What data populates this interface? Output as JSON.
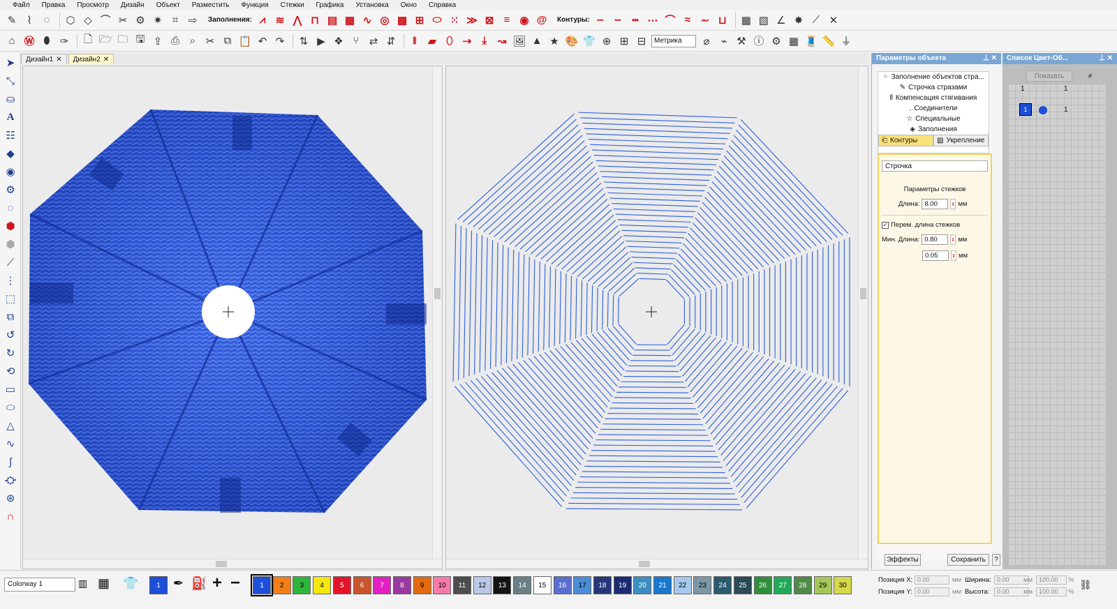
{
  "menu": [
    "Файл",
    "Правка",
    "Просмотр",
    "Дизайн",
    "Объект",
    "Разместить",
    "Функция",
    "Стежки",
    "Графика",
    "Установка",
    "Окно",
    "Справка"
  ],
  "toolbar": {
    "fills_label": "Заполнения:",
    "contours_label": "Контуры:",
    "units_value": "Метрика"
  },
  "tabs": [
    {
      "label": "Дизайн1",
      "active": false
    },
    {
      "label": "Дизайн2",
      "active": true
    }
  ],
  "props": {
    "title": "Параметры объекта",
    "items": [
      "Заполнение объектов стра...",
      "Строчка стразами",
      "Компенсация стягивания",
      "Соединители",
      "Специальные",
      "Заполнения"
    ],
    "tab_contours": "Контуры",
    "tab_reinforce": "Укрепление",
    "stitch_type": "Строчка",
    "section_label": "Параметры стежков",
    "length_label": "Длина:",
    "length_value": "8.00",
    "unit": "мм",
    "var_length_label": "Перем. длина стежков",
    "min_length_label": "Мин. Длина:",
    "min_length_value": "0.80",
    "extra_value": "0.05",
    "effects_button": "Эффекты",
    "save_button": "Сохранить",
    "help_button": "?"
  },
  "colorlist": {
    "title": "Список Цвет-Об...",
    "show_button": "Показать",
    "header_left": "1",
    "header_right": "1",
    "hash": "#",
    "row_swatch": "1",
    "row_count": "1"
  },
  "status": {
    "colorway": "Colorway 1",
    "current_color": "1",
    "pos_x_label": "Позиция X:",
    "pos_y_label": "Позиция Y:",
    "pos_x": "0.00",
    "pos_y": "0.00",
    "width_label": "Ширина:",
    "height_label": "Высота:",
    "width": "0.00",
    "height": "0.00",
    "scale_w": "100.00",
    "scale_h": "100.00",
    "pct": "%",
    "unit": "мм"
  },
  "palette": [
    {
      "n": "1",
      "color": "#1e4fd8"
    },
    {
      "n": "2",
      "color": "#f07f17"
    },
    {
      "n": "3",
      "color": "#2db53a"
    },
    {
      "n": "4",
      "color": "#f5e60e"
    },
    {
      "n": "5",
      "color": "#e4152a"
    },
    {
      "n": "6",
      "color": "#c9552c"
    },
    {
      "n": "7",
      "color": "#e21fc3"
    },
    {
      "n": "8",
      "color": "#9a3aa0"
    },
    {
      "n": "9",
      "color": "#e36a10"
    },
    {
      "n": "10",
      "color": "#f57aa9"
    },
    {
      "n": "11",
      "color": "#4d4d4d"
    },
    {
      "n": "12",
      "color": "#b9c9e9"
    },
    {
      "n": "13",
      "color": "#141414"
    },
    {
      "n": "14",
      "color": "#6a8087"
    },
    {
      "n": "15",
      "color": "#ffffff"
    },
    {
      "n": "16",
      "color": "#5a6fd2"
    },
    {
      "n": "17",
      "color": "#4a8dd9"
    },
    {
      "n": "18",
      "color": "#25367a"
    },
    {
      "n": "19",
      "color": "#1c2c74"
    },
    {
      "n": "20",
      "color": "#3a8fc0"
    },
    {
      "n": "21",
      "color": "#1878cc"
    },
    {
      "n": "22",
      "color": "#a6c9eb"
    },
    {
      "n": "23",
      "color": "#7c97a6"
    },
    {
      "n": "24",
      "color": "#2a5a6e"
    },
    {
      "n": "25",
      "color": "#2b4a58"
    },
    {
      "n": "26",
      "color": "#2f8f3a"
    },
    {
      "n": "27",
      "color": "#22aa58"
    },
    {
      "n": "28",
      "color": "#4f8a48"
    },
    {
      "n": "29",
      "color": "#a4c65a"
    },
    {
      "n": "30",
      "color": "#d5d94a"
    }
  ]
}
